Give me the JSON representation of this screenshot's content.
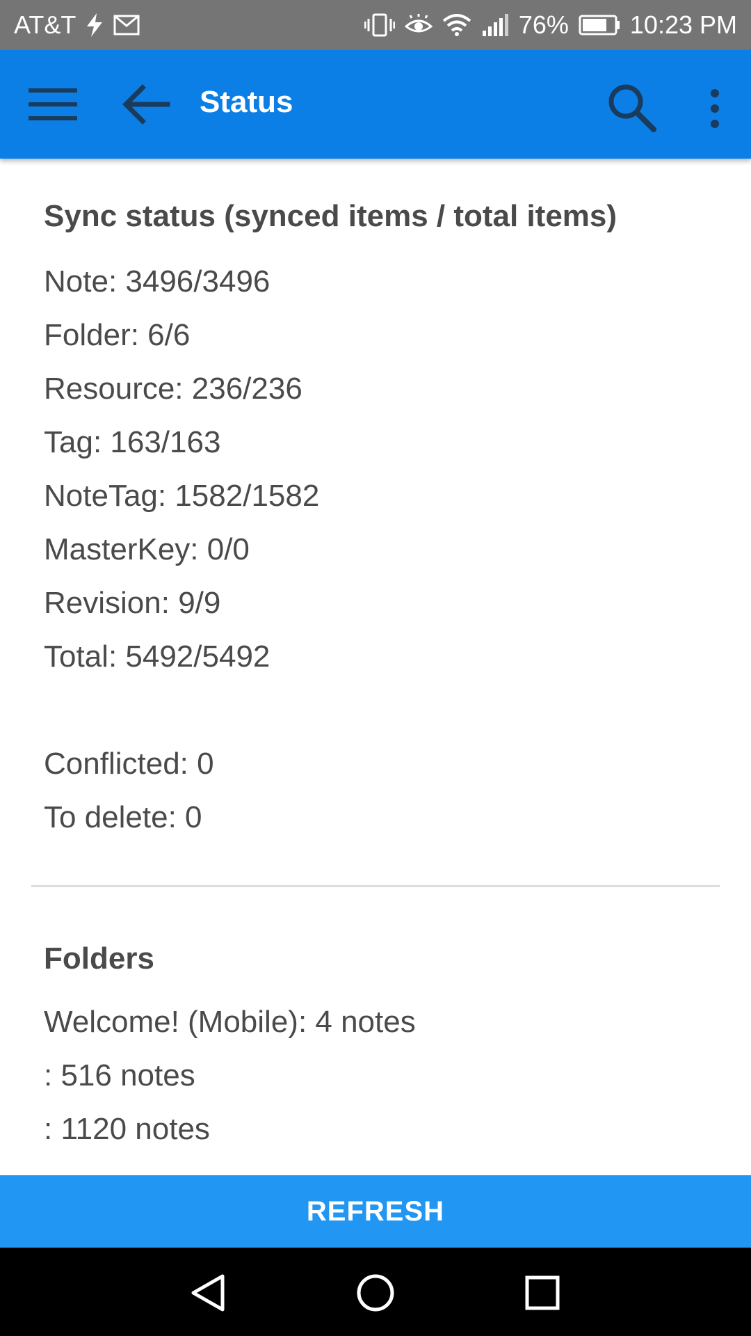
{
  "status_bar": {
    "carrier": "AT&T",
    "battery_percent": "76%",
    "time": "10:23 PM",
    "icons": [
      "flash-icon",
      "gmail-icon",
      "vibrate-icon",
      "eye-comfort-icon",
      "wifi-icon",
      "signal-icon",
      "battery-icon"
    ]
  },
  "app_bar": {
    "title": "Status",
    "color": "#0B7FE6"
  },
  "sync_status": {
    "title": "Sync status (synced items / total items)",
    "lines": [
      "Note: 3496/3496",
      "Folder: 6/6",
      "Resource: 236/236",
      "Tag: 163/163",
      "NoteTag: 1582/1582",
      "MasterKey: 0/0",
      "Revision: 9/9",
      "Total: 5492/5492"
    ],
    "extra_lines": [
      "Conflicted: 0",
      "To delete: 0"
    ]
  },
  "folders": {
    "title": "Folders",
    "lines": [
      "Welcome! (Mobile): 4 notes",
      ": 516 notes",
      ": 1120 notes"
    ]
  },
  "refresh_button": {
    "label": "REFRESH",
    "color": "#2196F3"
  }
}
